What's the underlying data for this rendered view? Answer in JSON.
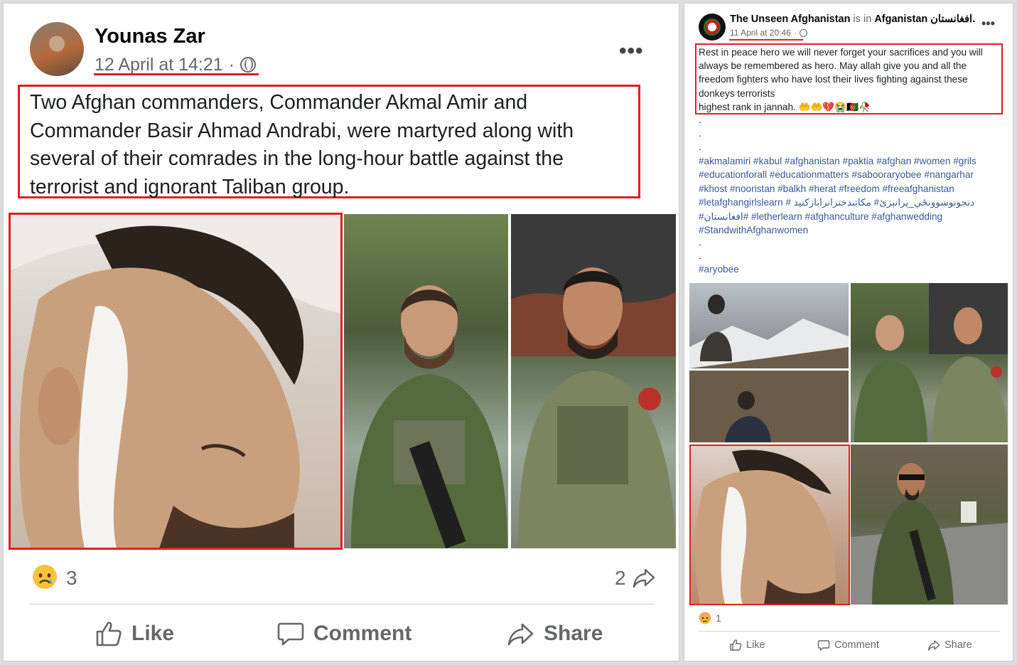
{
  "left_post": {
    "author": "Younas Zar",
    "timestamp": "12 April at 14:21",
    "separator": "·",
    "body": "Two Afghan commanders, Commander Akmal Amir and Commander Basir Ahmad Andrabi, were martyred along with several of their comrades in the long-hour battle against the terrorist and ignorant Taliban group.",
    "reaction_count": "3",
    "share_count": "2",
    "actions": {
      "like": "Like",
      "comment": "Comment",
      "share": "Share"
    },
    "more_icon": "more-horizontal-icon",
    "reaction_icon": "sad-emoji-icon",
    "highlight_color": "#e02020"
  },
  "right_post": {
    "page_name": "The Unseen Afghanistan",
    "is_in": "is in",
    "location": "Afganistan افغانستان.",
    "timestamp": "11 April at 20:46",
    "separator": "·",
    "body_lines": [
      "Rest in peace hero we will never forget your sacrifices and you will",
      "always be remembered as hero. May allah give you and all the",
      "freedom fighters who have lost their lives fighting against these",
      "donkeys terrorists",
      "highest rank in jannah. 🤲🤲💔😭🇦🇫🥀"
    ],
    "dots": [
      ".",
      ".",
      "."
    ],
    "hashtag_lines": [
      "#akmalamiri #kabul #afghanistan #paktia #afghan #women #grils",
      "#educationforall #educationmatters #sabooraryobee #nangarhar",
      "#khost #nooristan #balkh #herat #freedom #freeafghanistan",
      "#letafghangirlslearn # دنجونوښوونځي_پرانېزئ# مكاتبدخترانرابازكنيد",
      "#افغانستان# #letherlearn #afghanculture #afghanwedding",
      "#StandwithAfghanwomen"
    ],
    "dots2": [
      ".",
      "."
    ],
    "last_tag": "#aryobee",
    "reaction_count": "1",
    "actions": {
      "like": "Like",
      "comment": "Comment",
      "share": "Share"
    },
    "more_icon": "more-horizontal-icon",
    "reaction_icon": "angry-emoji-icon"
  }
}
